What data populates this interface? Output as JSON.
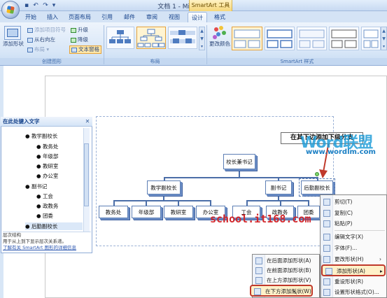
{
  "window": {
    "title": "文档 1 - Microsoft Word",
    "context_tab": "SmartArt 工具"
  },
  "quick_access": [
    "save-icon",
    "undo-icon",
    "redo-icon",
    "customize-icon"
  ],
  "tabs": [
    "开始",
    "插入",
    "页面布局",
    "引用",
    "邮件",
    "审阅",
    "视图",
    "设计",
    "格式"
  ],
  "active_tab": "设计",
  "ribbon": {
    "create": {
      "add_shape": "添加形状",
      "add_bullet": "添加项目符号",
      "rtl": "从右向左",
      "layout": "布局",
      "promote": "升级",
      "demote": "降级",
      "text_pane": "文本窗格",
      "label": "创建图形"
    },
    "layouts_label": "布局",
    "change_colors": "更改颜色",
    "styles_label": "SmartArt 样式"
  },
  "text_pane": {
    "title": "在此处键入文字",
    "items": [
      {
        "text": "教学副校长",
        "level": 1
      },
      {
        "text": "教务处",
        "level": 2
      },
      {
        "text": "年级部",
        "level": 2
      },
      {
        "text": "教研室",
        "level": 2
      },
      {
        "text": "办公室",
        "level": 2
      },
      {
        "text": "副书记",
        "level": 1
      },
      {
        "text": "工会",
        "level": 2
      },
      {
        "text": "政教务",
        "level": 2
      },
      {
        "text": "团委",
        "level": 2
      },
      {
        "text": "后勤副校长",
        "level": 1
      }
    ],
    "info_title": "层次结构",
    "info_desc": "用于从上到下显示层次关系递。",
    "info_link": "了解有关 SmartArt 图形的详细信息"
  },
  "chart": {
    "top": "校长兼书记",
    "level2": [
      "教学副校长",
      "副书记",
      "后勤副校长"
    ],
    "level3": [
      "教务处",
      "年级部",
      "教研室",
      "办公室",
      "工会",
      "政教务",
      "团委"
    ]
  },
  "annotation": {
    "callout": "在其下边添加下级分支"
  },
  "watermarks": {
    "brand": "Word联盟",
    "url": "www.wordlm.com",
    "school": "school.it168.com"
  },
  "context_menu": {
    "items": [
      "剪切(T)",
      "复制(C)",
      "粘贴(P)",
      "编辑文字(X)",
      "字体(F)...",
      "更改形状(H)",
      "添加形状(A)",
      "重设形状(R)",
      "设置形状格式(O)..."
    ],
    "highlighted": "添加形状(A)"
  },
  "submenu": {
    "items": [
      "在后面添加形状(A)",
      "在前面添加形状(B)",
      "在上方添加形状(V)",
      "在下方添加形状(W)"
    ],
    "highlighted": "在下方添加形状(W)"
  },
  "colors": {
    "accent": "#c0392b",
    "ribbon": "#d7e6f7",
    "node_border": "#5d7fb5"
  }
}
